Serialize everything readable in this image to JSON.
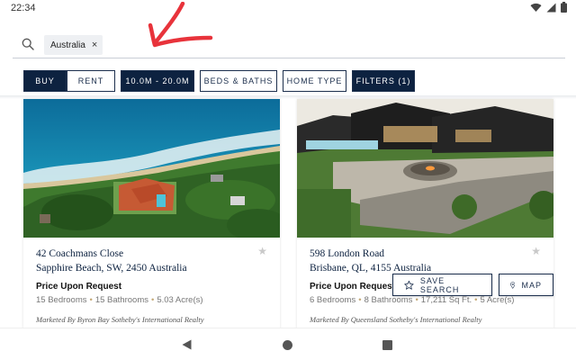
{
  "status_bar": {
    "time": "22:34"
  },
  "search": {
    "chip_label": "Australia",
    "chip_remove": "×"
  },
  "filters": {
    "buy": "BUY",
    "rent": "RENT",
    "price": "10.0M - 20.0M",
    "beds_baths": "BEDS & BATHS",
    "home_type": "HOME TYPE",
    "more": "FILTERS (1)"
  },
  "listings": [
    {
      "address_line1": "42 Coachmans Close",
      "address_line2": "Sapphire Beach, SW, 2450 Australia",
      "price": "Price Upon Request",
      "bedrooms": "15 Bedrooms",
      "bathrooms": "15 Bathrooms",
      "area": "5.03 Acre(s)",
      "broker": "Marketed By Byron Bay Sotheby's International Realty"
    },
    {
      "address_line1": "598 London Road",
      "address_line2": "Brisbane, QL, 4155 Australia",
      "price": "Price Upon Request",
      "bedrooms": "6 Bedrooms",
      "bathrooms": "8 Bathrooms",
      "sqft": "17,211 Sq Ft.",
      "area": "5 Acre(s)",
      "broker": "Marketed By Queensland Sotheby's International Realty"
    }
  ],
  "actions": {
    "save_search": "SAVE SEARCH",
    "map": "MAP"
  },
  "colors": {
    "navy": "#0d2240",
    "accent_dot": "#c4a875",
    "annotation": "#e8333b"
  },
  "icons": [
    "search-icon",
    "star-icon",
    "map-pin-icon",
    "wifi-icon",
    "signal-icon",
    "battery-icon",
    "back-icon",
    "home-icon",
    "recents-icon"
  ]
}
